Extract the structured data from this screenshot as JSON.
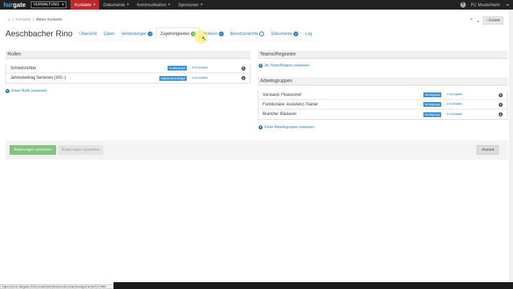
{
  "topbar": {
    "logo_a": "fair",
    "logo_b": "gate",
    "dropdown": "VERWALTUNG",
    "menu": [
      {
        "label": "Kontakte",
        "active": true
      },
      {
        "label": "Dokumente",
        "active": false
      },
      {
        "label": "Kommunikation",
        "active": false
      },
      {
        "label": "Sponsoren",
        "active": false
      }
    ],
    "help_icon": "question-icon",
    "club": "FC Musterheim",
    "logout_icon": "logout-icon"
  },
  "breadcrumb": {
    "home_icon": "home-icon",
    "level1": "Kontakte",
    "level2": "Aktive Kontakte"
  },
  "nav": {
    "back_label": "Zurück"
  },
  "page": {
    "title": "Aeschbacher Rino"
  },
  "tabs": [
    {
      "label": "Übersicht"
    },
    {
      "label": "Daten"
    },
    {
      "label": "Verbindungen",
      "badge": "4"
    },
    {
      "label": "Zugehörigkeiten",
      "badge": "5",
      "active": true
    },
    {
      "label": "Notizen",
      "badge": "2"
    },
    {
      "label": "Benutzerrechte",
      "check": "✓"
    },
    {
      "label": "Dokumente",
      "badge": "2"
    },
    {
      "label": "Log"
    }
  ],
  "rollen": {
    "title": "Rollen",
    "rows": [
      {
        "label": "Schiedsrichter",
        "tag": "Funktionäre",
        "link": "8 Kontakte"
      },
      {
        "label": "Jahresbeitrag Senioren (100.-)",
        "tag": "Mitgliederbeiträge",
        "link": "3 Kontakte"
      }
    ],
    "add_label": "Einer Rolle zuweisen"
  },
  "teams": {
    "title": "Teams/Regionen",
    "add_label": "An Team/Region zuweisen"
  },
  "arbeitsgruppen": {
    "title": "Arbeitsgruppen",
    "rows": [
      {
        "label": "Vorstand: Finanzchef",
        "tag": "Workgroup",
        "link": "7 Kontakte"
      },
      {
        "label": "Funktionäre: Assistenz-Trainer",
        "tag": "Workgroup",
        "link": "3 Kontakte"
      },
      {
        "label": "Branche: Bäckerei",
        "tag": "Workgroup",
        "link": "3 Kontakte"
      }
    ],
    "add_label": "Einer Arbeitsgruppe zuweisen"
  },
  "footer": {
    "save_label": "Änderungen speichern",
    "discard_label": "Änderungen verwerfen",
    "back_label": "Zurück"
  },
  "statusbar": {
    "url": "https://mein.fairgate.ch/fcmusterheim/backend/contact/assignments/7/17995"
  }
}
